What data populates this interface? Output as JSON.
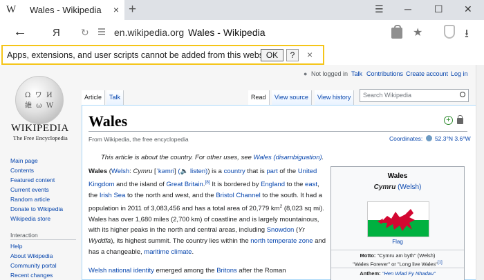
{
  "browser": {
    "tab_favicon": "W",
    "tab_title": "Wales - Wikipedia",
    "tab_close": "×",
    "new_tab": "+",
    "win_minimize": "─",
    "win_maximize": "☐",
    "win_close": "✕",
    "win_menu": "☰",
    "back": "←",
    "yandex": "Я",
    "reload": "↻",
    "url_host": "en.wikipedia.org",
    "url_title": "Wales - Wikipedia",
    "bookmark": "★",
    "download": "⭳"
  },
  "infobar": {
    "message": "Apps, extensions, and user scripts cannot be added from this website.",
    "ok_label": "OK",
    "help_label": "?",
    "close_label": "×"
  },
  "personal": {
    "not_logged_in": "Not logged in",
    "talk": "Talk",
    "contributions": "Contributions",
    "create_account": "Create account",
    "log_in": "Log in"
  },
  "logo": {
    "wordmark": "WIKIPEDIA",
    "tagline": "The Free Encyclopedia"
  },
  "sidebar": {
    "items": [
      "Main page",
      "Contents",
      "Featured content",
      "Current events",
      "Random article",
      "Donate to Wikipedia",
      "Wikipedia store"
    ],
    "interaction_heading": "Interaction",
    "interaction_items": [
      "Help",
      "About Wikipedia",
      "Community portal",
      "Recent changes"
    ]
  },
  "tabs": {
    "article": "Article",
    "talk": "Talk",
    "read": "Read",
    "view_source": "View source",
    "view_history": "View history"
  },
  "search": {
    "placeholder": "Search Wikipedia"
  },
  "article": {
    "title": "Wales",
    "from": "From Wikipedia, the free encyclopedia",
    "coordinates_label": "Coordinates:",
    "coordinates_value": "52.3°N 3.6°W",
    "hatnote_prefix": "This article is about the country. For other uses, see ",
    "hatnote_link": "Wales (disambiguation)",
    "hatnote_suffix": ".",
    "p2_prefix": "Welsh national identity",
    "p2_mid": " emerged among the ",
    "p2_link": "Britons",
    "p2_suffix": " after the Roman"
  },
  "infobox": {
    "title": "Wales",
    "native_name": "Cymru",
    "native_lang": "(Welsh)",
    "flag_caption": "Flag",
    "motto_label": "Motto:",
    "motto_value": "\"Cymru am byth\" (Welsh)",
    "motto_translation": "\"Wales Forever\" or \"Long live Wales\"",
    "motto_ref": "[1]",
    "anthem_label": "Anthem:",
    "anthem_value": "\"Hen Wlad Fy Nhadau\""
  },
  "colors": {
    "accent": "#f5c518",
    "link": "#0645ad",
    "flag_green": "#00b140",
    "flag_red": "#d30731"
  }
}
